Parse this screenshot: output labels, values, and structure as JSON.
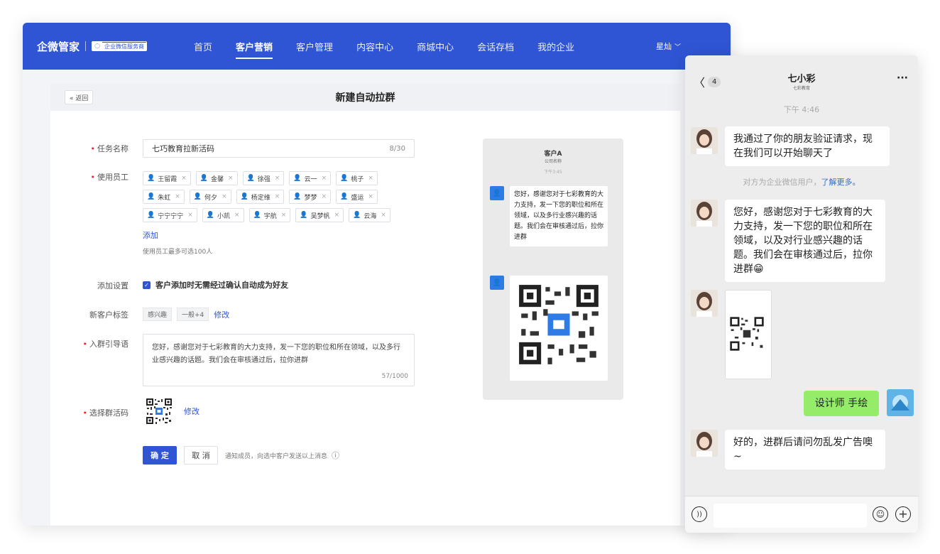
{
  "nav": {
    "logo": "企微管家",
    "badge": "企业微信服务商",
    "menu": [
      "首页",
      "客户营销",
      "客户管理",
      "内容中心",
      "商城中心",
      "会话存档",
      "我的企业"
    ],
    "active": "客户营销",
    "user": "星灿"
  },
  "page": {
    "back": "« 返回",
    "title": "新建自动拉群"
  },
  "form": {
    "task_label": "任务名称",
    "task_value": "七巧教育拉新活码",
    "task_count": "8/30",
    "staff_label": "使用员工",
    "staff_rows": [
      [
        "王留霞",
        "金馨",
        "徐强",
        "云一",
        "桃子"
      ],
      [
        "朱虹",
        "何夕",
        "杨定维",
        "梦梦",
        "盛运"
      ],
      [
        "宁宁宁宁",
        "小凯",
        "宇航",
        "吴梦帆",
        "云海"
      ]
    ],
    "staff_add": "添加",
    "staff_hint": "使用员工最多可选100人",
    "setting_label": "添加设置",
    "setting_text": "客户添加时无需经过确认自动成为好友",
    "newtag_label": "新客户标签",
    "newtags": [
      "感兴趣",
      "一般+4"
    ],
    "newtag_edit": "修改",
    "guide_label": "入群引导语",
    "guide_text": "您好，感谢您对于七彩教育的大力支持，发一下您的职位和所在领域，以及多行业感兴趣的话题。我们会在审核通过后，拉你进群",
    "guide_count": "57/1000",
    "code_label": "选择群活码",
    "code_edit": "修改",
    "confirm": "确 定",
    "cancel": "取 消",
    "notice": "通知成员，向选中客户发送以上消息"
  },
  "preview": {
    "name": "客户A",
    "company": "公司名称",
    "time": "下午3:45",
    "message": "您好，感谢您对于七彩教育的大力支持，发一下您的职位和所在领域，以及多行业感兴趣的话题。我们会在审核通过后，拉你进群"
  },
  "phone": {
    "back_count": "4",
    "name": "七小彩",
    "sub": "七彩教育",
    "time": "下午 4:46",
    "msg1": "我通过了你的朋友验证请求，现在我们可以开始聊天了",
    "sys_text": "对方为企业微信用户，",
    "sys_link": "了解更多。",
    "msg2": "您好，感谢您对于七彩教育的大力支持，发一下您的职位和所在领域，以及对行业感兴趣的话题。我们会在审核通过后，拉你进群😁",
    "my_msg": "设计师 手绘",
    "msg3": "好的，进群后请问勿乱发广告噢~"
  }
}
